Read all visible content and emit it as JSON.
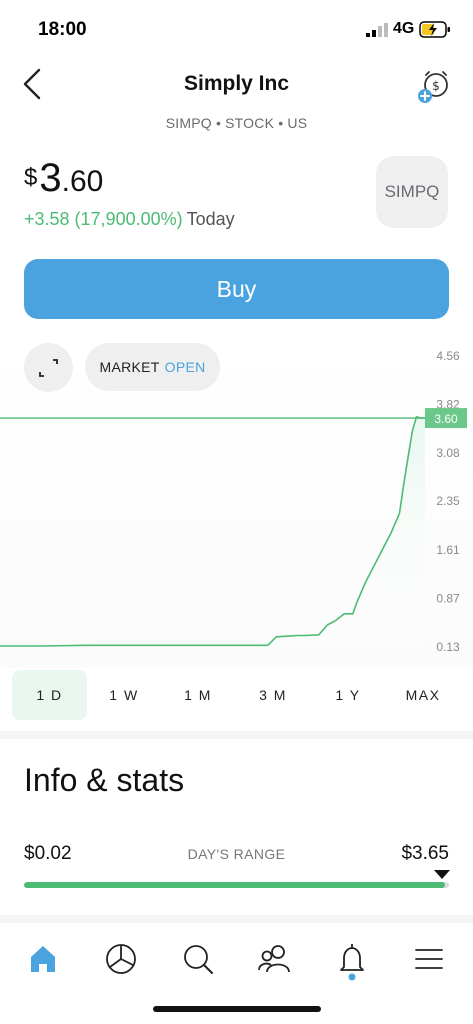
{
  "status_bar": {
    "time": "18:00",
    "network": "4G"
  },
  "header": {
    "title": "Simply Inc",
    "subtitle": "SIMPQ • STOCK • US",
    "back_icon": "chevron-left-icon",
    "alert_icon": "add-price-alert-icon"
  },
  "quote": {
    "currency": "$",
    "price_int": "3",
    "price_dec": ".60",
    "change": "+3.58 (17,900.00%)",
    "period": "Today",
    "ticker_logo": "SIMPQ"
  },
  "actions": {
    "buy_label": "Buy"
  },
  "market": {
    "prefix": "MARKET",
    "status": "OPEN"
  },
  "chart_data": {
    "type": "line",
    "y_ticks": [
      "4.56",
      "3.82",
      "3.60",
      "3.08",
      "2.35",
      "1.61",
      "0.87",
      "0.13"
    ],
    "current_value": 3.6,
    "current_label": "3.60",
    "ylim": [
      0.13,
      4.56
    ],
    "grid": false,
    "colors": {
      "line": "#4cbb74",
      "fill": "#e9f7ef"
    },
    "x": [
      0,
      0.1,
      0.2,
      0.3,
      0.4,
      0.5,
      0.6,
      0.63,
      0.65,
      0.68,
      0.7,
      0.72,
      0.75,
      0.77,
      0.79,
      0.81,
      0.83,
      0.84,
      0.86,
      0.88,
      0.9,
      0.92,
      0.94,
      0.95,
      0.96,
      0.97,
      0.98,
      0.99,
      1.0
    ],
    "values": [
      0.13,
      0.13,
      0.14,
      0.14,
      0.14,
      0.14,
      0.14,
      0.14,
      0.27,
      0.28,
      0.29,
      0.29,
      0.3,
      0.45,
      0.52,
      0.62,
      0.62,
      0.8,
      1.1,
      1.35,
      1.6,
      1.85,
      2.15,
      2.6,
      3.0,
      3.4,
      3.62,
      3.6,
      3.6
    ]
  },
  "time_ranges": [
    "1 D",
    "1 W",
    "1 M",
    "3 M",
    "1 Y",
    "MAX"
  ],
  "time_range_active": "1 D",
  "info": {
    "title": "Info & stats",
    "day_range_label": "DAY'S RANGE",
    "day_low": "$0.02",
    "day_high": "$3.65",
    "day_position": 0.99
  },
  "tabbar": {
    "items": [
      "home-icon",
      "portfolio-pie-icon",
      "search-icon",
      "social-people-icon",
      "notifications-bell-icon",
      "menu-icon"
    ],
    "active": "home-icon",
    "accent": "#4aa3df"
  }
}
